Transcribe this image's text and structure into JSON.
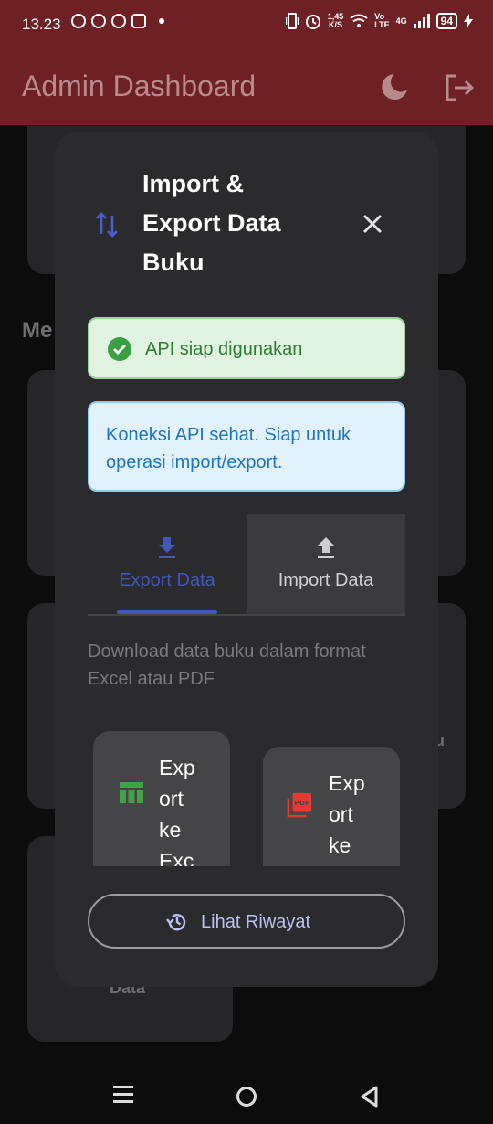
{
  "status_bar": {
    "time": "13.23",
    "speed_value": "1,45",
    "speed_unit": "K/S",
    "network_top": "Vo",
    "network_bottom": "LTE",
    "network_type": "4G",
    "battery": "94"
  },
  "app_bar": {
    "title": "Admin Dashboard",
    "theme_icon": "moon-icon",
    "logout_icon": "logout-icon"
  },
  "background": {
    "section_heading": "Me",
    "card_text_right": "u",
    "card_text_bottom": "Data"
  },
  "dialog": {
    "title": "Import & Export Data Buku",
    "title_icon": "swap-vertical-icon",
    "close_icon": "close-icon",
    "status_message": "API siap digunakan",
    "info_message": "Koneksi API sehat. Siap untuk operasi import/export.",
    "tabs": [
      {
        "label": "Export Data",
        "icon": "download-icon",
        "active": true
      },
      {
        "label": "Import Data",
        "icon": "upload-icon",
        "active": false
      }
    ],
    "description": "Download data buku dalam format Excel atau PDF",
    "export_options": [
      {
        "label": "Export ke Excel",
        "icon": "table-icon",
        "color": "#43a047"
      },
      {
        "label": "Export ke PDF",
        "icon": "pdf-icon",
        "color": "#e53935"
      }
    ],
    "history_button": {
      "label": "Lihat Riwayat",
      "icon": "history-icon"
    }
  },
  "colors": {
    "app_bar": "#6e2125",
    "dialog_bg": "#2b2b2e",
    "accent": "#4257b8",
    "success_text": "#2e7d32",
    "info_text": "#1e75c0"
  }
}
